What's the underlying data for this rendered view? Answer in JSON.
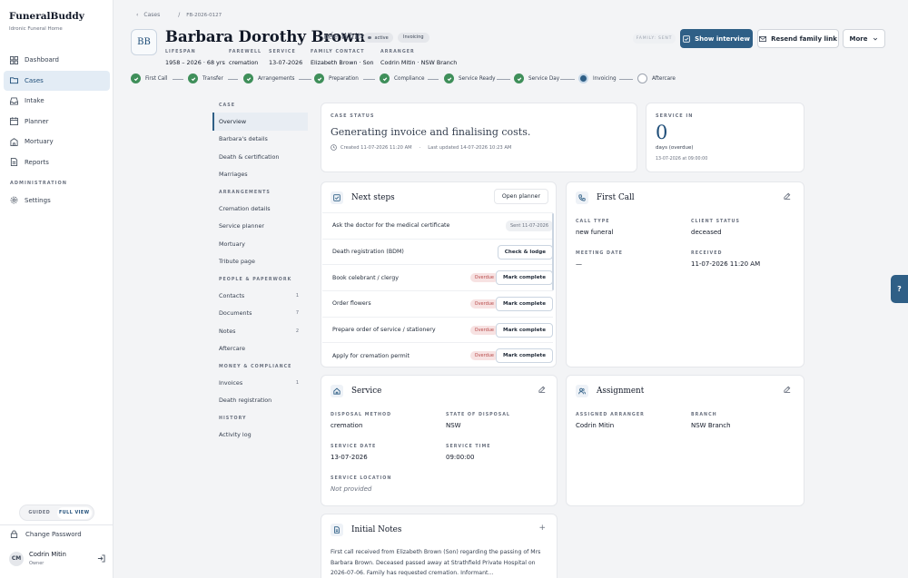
{
  "brand": {
    "name": "FuneralBuddy",
    "sub": "Idronic Funeral Home"
  },
  "nav": {
    "items": [
      {
        "label": "Dashboard",
        "icon": "grid-icon"
      },
      {
        "label": "Cases",
        "icon": "folder-icon"
      },
      {
        "label": "Intake",
        "icon": "inbox-icon"
      },
      {
        "label": "Planner",
        "icon": "calendar-icon"
      },
      {
        "label": "Mortuary",
        "icon": "building-icon"
      },
      {
        "label": "Reports",
        "icon": "file-icon"
      }
    ],
    "admin_section": "ADMINISTRATION",
    "settings": "Settings",
    "mode_guided": "GUIDED",
    "mode_full": "FULL VIEW",
    "change_password": "Change Password",
    "user_initials": "CM",
    "user_name": "Codrin Mitin",
    "user_role": "Owner"
  },
  "breadcrumb": {
    "back": "Cases",
    "sep": "/",
    "case_id": "FB-2026-0127"
  },
  "header": {
    "monogram": "BB",
    "name": "Barbara Dorothy Brown",
    "nee": "née White",
    "status_badge": "active",
    "stage_badge": "Invoicing",
    "meta": [
      {
        "label": "LIFESPAN",
        "value": "1958 – 2026 · 68 yrs"
      },
      {
        "label": "FAREWELL",
        "value": "cremation"
      },
      {
        "label": "SERVICE",
        "value": "13-07-2026"
      },
      {
        "label": "FAMILY CONTACT",
        "value": "Elizabeth Brown · Son"
      },
      {
        "label": "ARRANGER",
        "value": "Codrin Mitin · NSW Branch"
      }
    ],
    "family_sent": "FAMILY: SENT",
    "show_interview": "Show interview",
    "resend": "Resend family link",
    "more": "More"
  },
  "stepper": [
    {
      "label": "First Call",
      "state": "done"
    },
    {
      "label": "Transfer",
      "state": "done"
    },
    {
      "label": "Arrangements",
      "state": "done"
    },
    {
      "label": "Preparation",
      "state": "done"
    },
    {
      "label": "Compliance",
      "state": "done"
    },
    {
      "label": "Service Ready",
      "state": "done"
    },
    {
      "label": "Service Day",
      "state": "done"
    },
    {
      "label": "Invoicing",
      "state": "current"
    },
    {
      "label": "Aftercare",
      "state": "todo"
    }
  ],
  "subnav": {
    "case_section": "CASE",
    "case_items": [
      "Overview",
      "Barbara's details",
      "Death & certification",
      "Marriages"
    ],
    "arr_section": "ARRANGEMENTS",
    "arr_items": [
      "Cremation details",
      "Service planner",
      "Mortuary",
      "Tribute page"
    ],
    "people_section": "PEOPLE & PAPERWORK",
    "people_items": [
      {
        "label": "Contacts",
        "count": "1"
      },
      {
        "label": "Documents",
        "count": "7"
      },
      {
        "label": "Notes",
        "count": "2"
      },
      {
        "label": "Aftercare",
        "count": ""
      }
    ],
    "money_section": "MONEY & COMPLIANCE",
    "money_items": [
      {
        "label": "Invoices",
        "count": "1"
      },
      {
        "label": "Death registration",
        "count": ""
      }
    ],
    "history_section": "HISTORY",
    "history_items": [
      "Activity log"
    ]
  },
  "case_status": {
    "label": "CASE STATUS",
    "title": "Generating invoice and finalising costs.",
    "created": "Created 11-07-2026 11:20 AM",
    "dot": "·",
    "updated": "Last updated 14-07-2026 10:23 AM"
  },
  "service_in": {
    "label": "SERVICE IN",
    "value": "0",
    "unit": "days (overdue)",
    "date": "13-07-2026 at 09:00:00"
  },
  "next_steps": {
    "title": "Next steps",
    "open_planner": "Open planner",
    "tasks": [
      {
        "label": "Ask the doctor for the medical certificate",
        "status": "",
        "action": "",
        "sent": "Sent 11-07-2026"
      },
      {
        "label": "Death registration (BDM)",
        "status": "",
        "action": "Check & lodge",
        "sent": ""
      },
      {
        "label": "Book celebrant / clergy",
        "status": "Overdue",
        "action": "Mark complete",
        "sent": ""
      },
      {
        "label": "Order flowers",
        "status": "Overdue",
        "action": "Mark complete",
        "sent": ""
      },
      {
        "label": "Prepare order of service / stationery",
        "status": "Overdue",
        "action": "Mark complete",
        "sent": ""
      },
      {
        "label": "Apply for cremation permit",
        "status": "Overdue",
        "action": "Mark complete",
        "sent": ""
      }
    ]
  },
  "first_call": {
    "title": "First Call",
    "call_type_label": "CALL TYPE",
    "call_type": "new funeral",
    "client_status_label": "CLIENT STATUS",
    "client_status": "deceased",
    "meeting_label": "MEETING DATE",
    "meeting": "—",
    "received_label": "RECEIVED",
    "received": "11-07-2026 11:20 AM"
  },
  "service": {
    "title": "Service",
    "disposal_label": "DISPOSAL METHOD",
    "disposal": "cremation",
    "state_label": "STATE OF DISPOSAL",
    "state": "NSW",
    "date_label": "SERVICE DATE",
    "date": "13-07-2026",
    "time_label": "SERVICE TIME",
    "time": "09:00:00",
    "location_label": "SERVICE LOCATION",
    "location": "Not provided"
  },
  "assignment": {
    "title": "Assignment",
    "arranger_label": "ASSIGNED ARRANGER",
    "arranger": "Codrin Mitin",
    "branch_label": "BRANCH",
    "branch": "NSW Branch"
  },
  "notes": {
    "title": "Initial Notes",
    "plus": "+",
    "text": "First call received from Elizabeth Brown (Son) regarding the passing of Mrs Barbara Brown. Deceased passed away at Strathfield Private Hospital on 2026-07-06. Family has requested cremation. Informant..."
  },
  "help": {
    "label": "?"
  }
}
